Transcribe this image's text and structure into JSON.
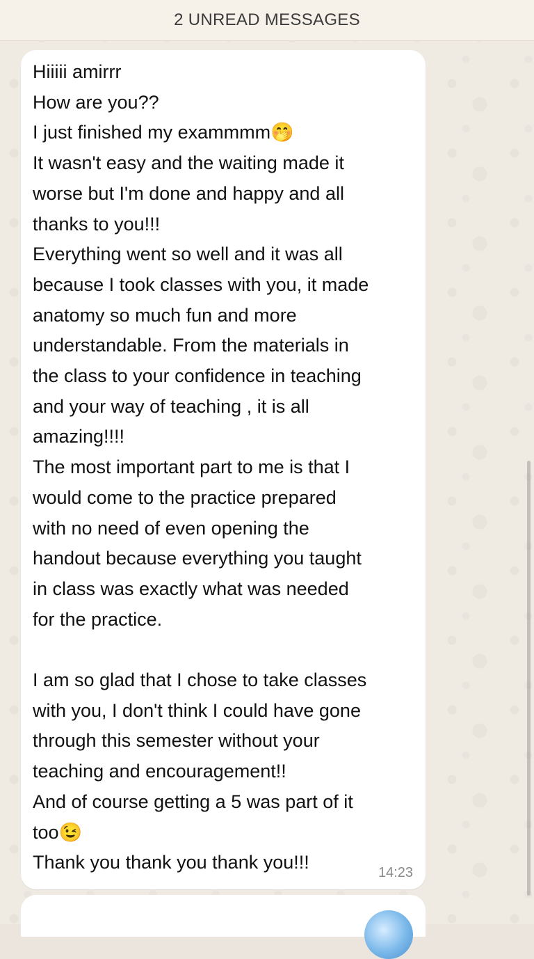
{
  "banner": {
    "unread_label": "2 UNREAD MESSAGES"
  },
  "message": {
    "text": "Hiiiii amirrr\nHow are you??\nI just finished my exammmm🤭\nIt wasn't easy and the waiting made it\nworse but I'm done and happy and all\nthanks to you!!!\nEverything went so well and it was all\nbecause I took classes with you, it made\nanatomy so much fun and more\nunderstandable. From the materials in\nthe class to your confidence in teaching\nand your way of teaching , it is all\namazing!!!!\nThe most important part to me is that I\nwould come to the practice prepared\nwith no need of even opening the\nhandout because everything you taught\nin class was exactly what was needed\nfor the practice.\n\nI am so glad that I chose to take classes\nwith you, I don't think I could have gone\nthrough this semester without your\nteaching and encouragement!!\nAnd of course getting a 5 was part of it\ntoo😉\nThank you thank you thank you!!!",
    "time": "14:23"
  },
  "colors": {
    "bubble": "#ffffff",
    "wallpaper": "#efeae2",
    "banner": "#f6f1e9",
    "timestamp": "#8a8a8a"
  }
}
